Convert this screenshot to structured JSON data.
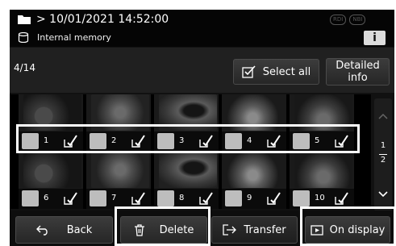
{
  "header": {
    "path": "> 10/01/2021 14:52:00",
    "badges": [
      "RDI",
      "NBI"
    ],
    "storage_label": "Internal memory",
    "info_label": "i"
  },
  "toolbar": {
    "count": "4/14",
    "select_all_label": "Select all",
    "detailed_info_line1": "Detailed",
    "detailed_info_line2": "info"
  },
  "thumbnails": [
    {
      "number": "1"
    },
    {
      "number": "2"
    },
    {
      "number": "3"
    },
    {
      "number": "4"
    },
    {
      "number": "5"
    },
    {
      "number": "6"
    },
    {
      "number": "7"
    },
    {
      "number": "8"
    },
    {
      "number": "9"
    },
    {
      "number": "10"
    }
  ],
  "pager": {
    "current": "1",
    "total": "2"
  },
  "footer": {
    "back_label": "Back",
    "delete_label": "Delete",
    "transfer_label": "Transfer",
    "on_display_label": "On display"
  },
  "colors": {
    "highlight": "#ffffff",
    "checkbox": "#bdbdbd",
    "background": "#111111"
  }
}
